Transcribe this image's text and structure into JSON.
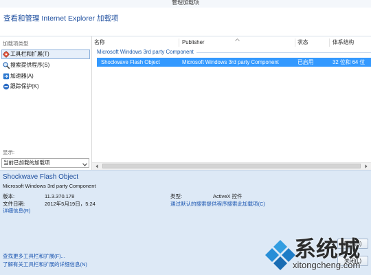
{
  "window": {
    "title": "管理加载项"
  },
  "header": {
    "title": "查看和管理 Internet Explorer 加载项"
  },
  "sidebar": {
    "section_label": "加载项类型",
    "items": [
      {
        "label": "工具栏和扩展(T)",
        "icon": "toolbar-extension-icon",
        "selected": true
      },
      {
        "label": "搜索提供程序(S)",
        "icon": "search-icon",
        "selected": false
      },
      {
        "label": "加速器(A)",
        "icon": "accelerator-icon",
        "selected": false
      },
      {
        "label": "跟踪保护(K)",
        "icon": "tracking-protection-icon",
        "selected": false
      }
    ],
    "show_label": "显示:",
    "show_select": {
      "value": "当前已加载的加载项",
      "icon": "chevron-down-icon"
    }
  },
  "list": {
    "columns": [
      "名称",
      "Publisher",
      "状态",
      "体系结构"
    ],
    "sort_icon": "sort-ascending-icon",
    "groups": [
      {
        "name": "Microsoft Windows 3rd party Component",
        "rows": [
          {
            "name": "Shockwave Flash Object",
            "publisher": "Microsoft Windows 3rd party Component",
            "status": "已启用",
            "architecture": "32 位和 64 位",
            "selected": true
          }
        ]
      }
    ],
    "scrollbar_icons": [
      "chevron-left-icon",
      "chevron-right-icon"
    ]
  },
  "details": {
    "name": "Shockwave Flash Object",
    "publisher": "Microsoft Windows 3rd party Component",
    "version_label": "版本:",
    "version": "11.3.370.178",
    "file_date_label": "文件日期:",
    "file_date": "2012年5月19日，5:24",
    "more_info_link": "详细信息(R)",
    "type_label": "类型:",
    "type": "ActiveX 控件",
    "search_link": "通过默认的搜索提供程序搜索此加载项(C)"
  },
  "footer": {
    "find_more_link": "查找更多工具栏和扩展(F)...",
    "learn_more_link": "了解有关工具栏和扩展的详细信息(N)",
    "disable_button": "禁用(B)",
    "close_button": "关闭(L)"
  },
  "watermark": {
    "brand": "系统城",
    "url": "xitongcheng.com",
    "icon": "xitongcheng-logo-icon"
  },
  "colors": {
    "selection": "#3399ff",
    "link": "#1a55b0",
    "heading": "#1f4f9f",
    "group_header": "#1e5aa8",
    "details_background": "#dde9f6"
  }
}
